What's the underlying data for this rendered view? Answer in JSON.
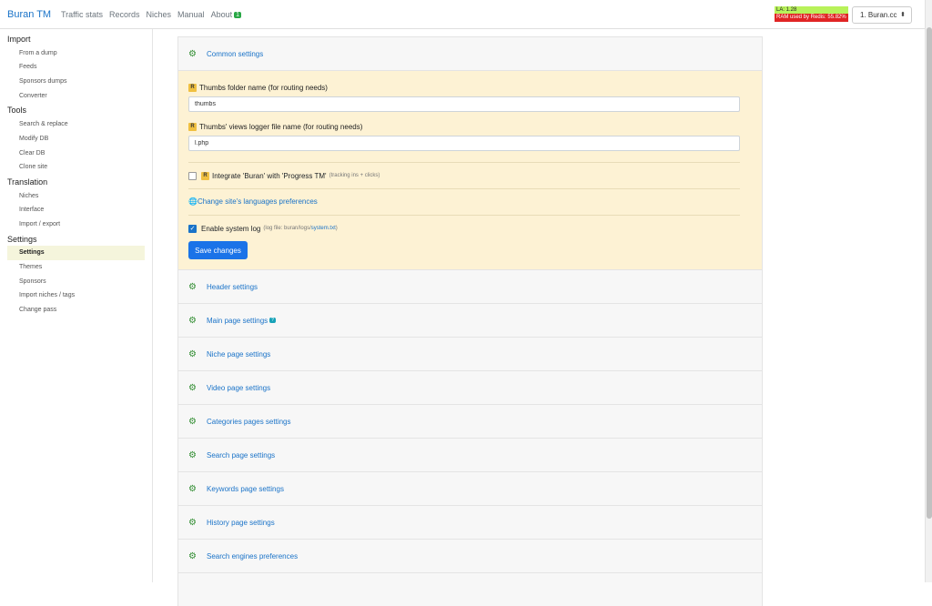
{
  "header": {
    "brand": "Buran TM",
    "nav": [
      "Traffic stats",
      "Records",
      "Niches",
      "Manual",
      "About"
    ],
    "about_badge": "1",
    "la": "LA: 1.28",
    "ram": "RAM used by Redis: 55.82%",
    "site_select": "1. Buran.cc"
  },
  "sidebar": {
    "sections": [
      {
        "title": "Import",
        "items": [
          "From a dump",
          "Feeds",
          "Sponsors dumps",
          "Converter"
        ]
      },
      {
        "title": "Tools",
        "items": [
          "Search & replace",
          "Modify DB",
          "Clear DB",
          "Clone site"
        ]
      },
      {
        "title": "Translation",
        "items": [
          "Niches",
          "Interface",
          "Import / export"
        ]
      },
      {
        "title": "Settings",
        "items": [
          "Settings",
          "Themes",
          "Sponsors",
          "Import niches / tags",
          "Change pass"
        ]
      }
    ],
    "active": "Settings"
  },
  "common": {
    "title": "Common settings",
    "r": "R",
    "thumbs_label": "Thumbs folder name (for routing needs)",
    "thumbs_value": "thumbs",
    "logger_label": "Thumbs' views logger file name (for routing needs)",
    "logger_value": "l.php",
    "integrate_label": "Integrate 'Buran' with 'Progress TM'",
    "integrate_note": "(tracking ins + clicks)",
    "languages_link": "Change site's languages preferences",
    "syslog_label": "Enable system log",
    "syslog_note": "(log file: buran/logs/",
    "syslog_file": "system.txt",
    "syslog_close": ")",
    "save": "Save changes"
  },
  "panels": [
    {
      "title": "Header settings",
      "badge": ""
    },
    {
      "title": "Main page settings",
      "badge": "?"
    },
    {
      "title": "Niche page settings",
      "badge": ""
    },
    {
      "title": "Video page settings",
      "badge": ""
    },
    {
      "title": "Categories pages settings",
      "badge": ""
    },
    {
      "title": "Search page settings",
      "badge": ""
    },
    {
      "title": "Keywords page settings",
      "badge": ""
    },
    {
      "title": "History page settings",
      "badge": ""
    },
    {
      "title": "Search engines preferences",
      "badge": ""
    }
  ]
}
